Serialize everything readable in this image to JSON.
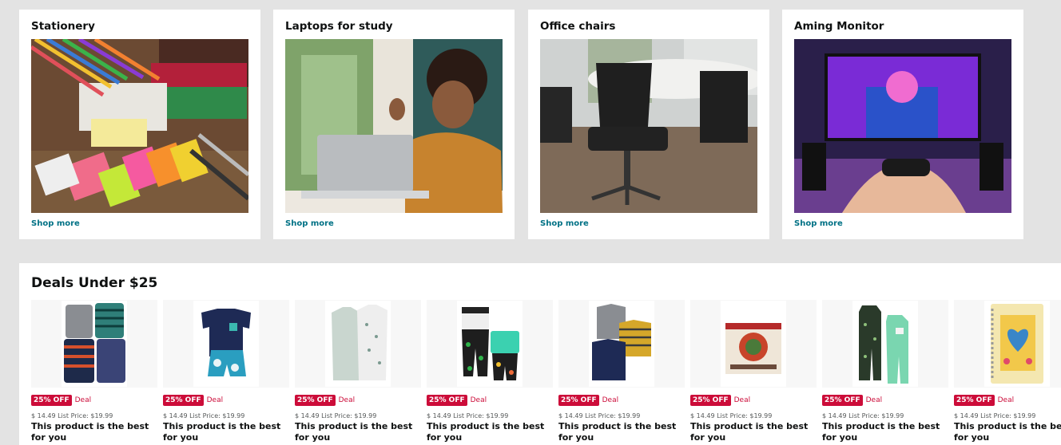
{
  "cards": [
    {
      "title": "Stationery",
      "link": "Shop more"
    },
    {
      "title": "Laptops for study",
      "link": "Shop more"
    },
    {
      "title": "Office chairs",
      "link": "Shop more"
    },
    {
      "title": "Aming Monitor",
      "link": "Shop more"
    }
  ],
  "deals": {
    "title": "Deals Under $25",
    "items": [
      {
        "badge": "25% OFF",
        "label": "Deal",
        "price": "$ 14.49 List Price: $19.99",
        "desc": "This product is the best for you"
      },
      {
        "badge": "25% OFF",
        "label": "Deal",
        "price": "$ 14.49 List Price: $19.99",
        "desc": "This product is the best for you"
      },
      {
        "badge": "25% OFF",
        "label": "Deal",
        "price": "$ 14.49 List Price: $19.99",
        "desc": "This product is the best for you"
      },
      {
        "badge": "25% OFF",
        "label": "Deal",
        "price": "$ 14.49 List Price: $19.99",
        "desc": "This product is the best for you"
      },
      {
        "badge": "25% OFF",
        "label": "Deal",
        "price": "$ 14.49 List Price: $19.99",
        "desc": "This product is the best for you"
      },
      {
        "badge": "25% OFF",
        "label": "Deal",
        "price": "$ 14.49 List Price: $19.99",
        "desc": "This product is the best for you"
      },
      {
        "badge": "25% OFF",
        "label": "Deal",
        "price": "$ 14.49 List Price: $19.99",
        "desc": "This product is the best for you"
      },
      {
        "badge": "25% OFF",
        "label": "Deal",
        "price": "$ 14.49 List Price: $19.99",
        "desc": "This product is the best for you"
      }
    ]
  }
}
